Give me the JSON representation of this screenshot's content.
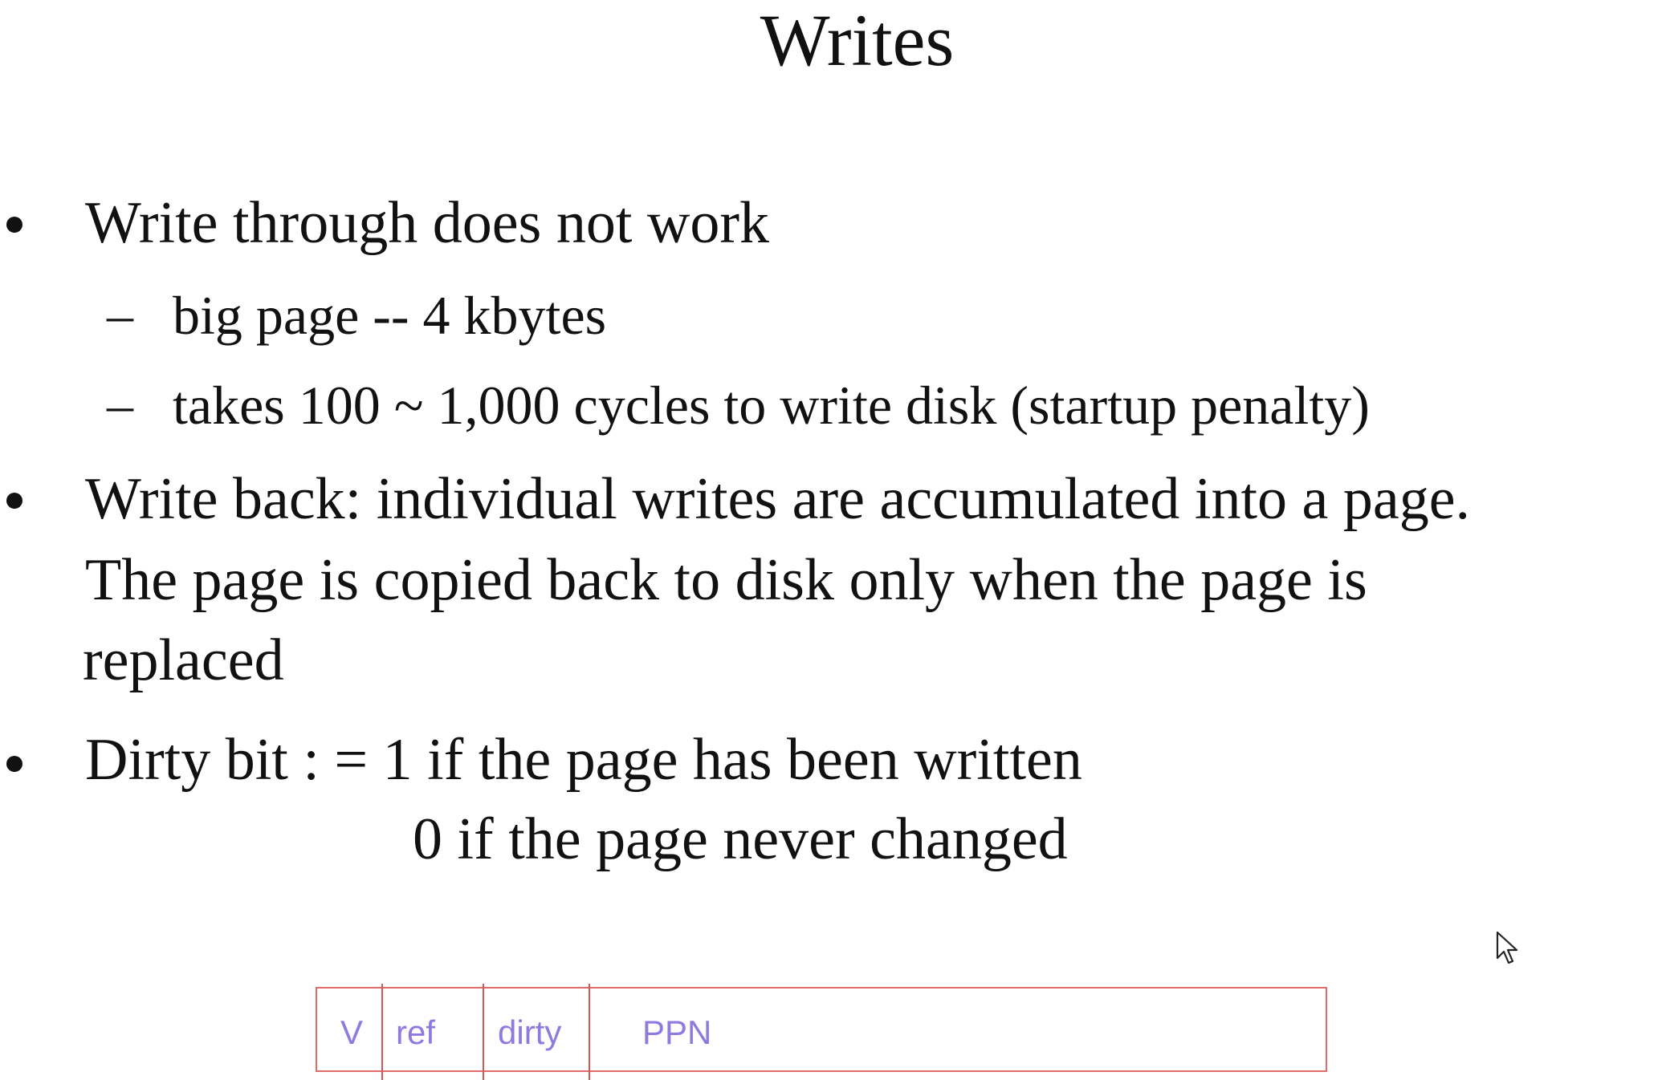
{
  "slide": {
    "title": "Writes",
    "bullets": [
      {
        "text": "Write through does not work",
        "sub": [
          "big page -- 4 kbytes",
          "takes 100 ~ 1,000 cycles to write disk (startup penalty)"
        ]
      },
      {
        "lines": [
          "Write back: individual writes are accumulated into a page.",
          "The page is copied back to disk only when the page is",
          "replaced"
        ]
      },
      {
        "lines": [
          "Dirty bit : = 1 if the page has been written",
          "0 if the page never changed"
        ]
      }
    ],
    "dash": "–",
    "page_table_entry": {
      "fields": [
        "V",
        "ref",
        "dirty",
        "PPN"
      ]
    }
  },
  "icons": {
    "cursor": "mouse-pointer-icon"
  },
  "colors": {
    "text": "#111111",
    "pte_border": "#e36a6a",
    "pte_label": "#8f7ae0"
  }
}
